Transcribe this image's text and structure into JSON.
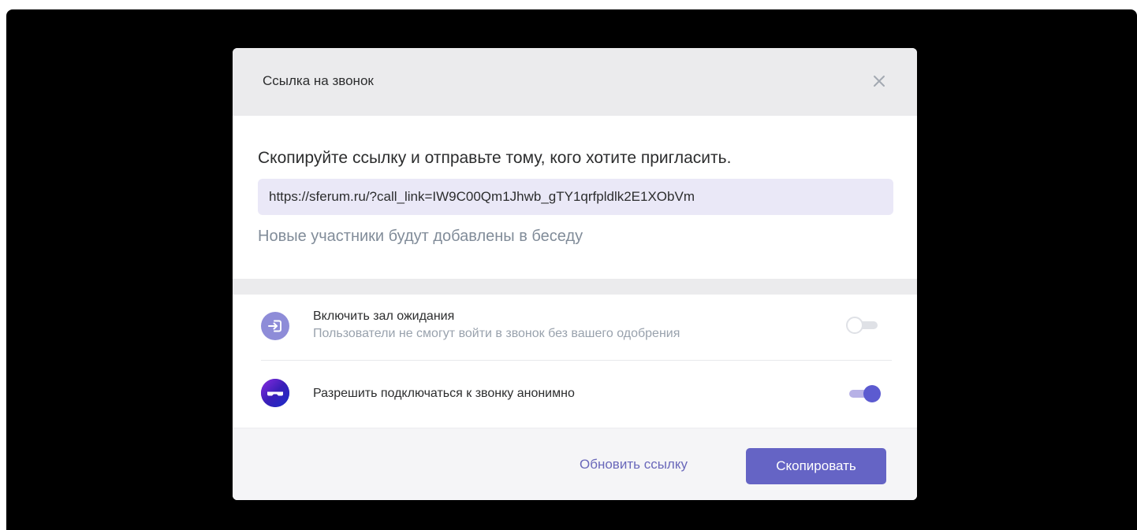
{
  "modal": {
    "title": "Ссылка на звонок",
    "close_icon": "close-icon"
  },
  "invite": {
    "instruction": "Скопируйте ссылку и отправьте тому, кого хотите пригласить.",
    "link": "https://sferum.ru/?call_link=IW9C00Qm1Jhwb_gTY1qrfpldlk2E1XObVm",
    "note": "Новые участники будут добавлены в беседу"
  },
  "settings": [
    {
      "icon": "waiting-room-enter-icon",
      "title": "Включить зал ожидания",
      "subtitle": "Пользователи не смогут войти в звонок без вашего одобрения",
      "enabled": false
    },
    {
      "icon": "anonymous-mask-icon",
      "title": "Разрешить подключаться к звонку анонимно",
      "enabled": true
    }
  ],
  "footer": {
    "refresh_label": "Обновить ссылку",
    "copy_label": "Скопировать"
  },
  "colors": {
    "accent": "#6564c5",
    "link_field_bg": "#eae8f7",
    "header_bg": "#ebebed",
    "backdrop": "#000000"
  }
}
